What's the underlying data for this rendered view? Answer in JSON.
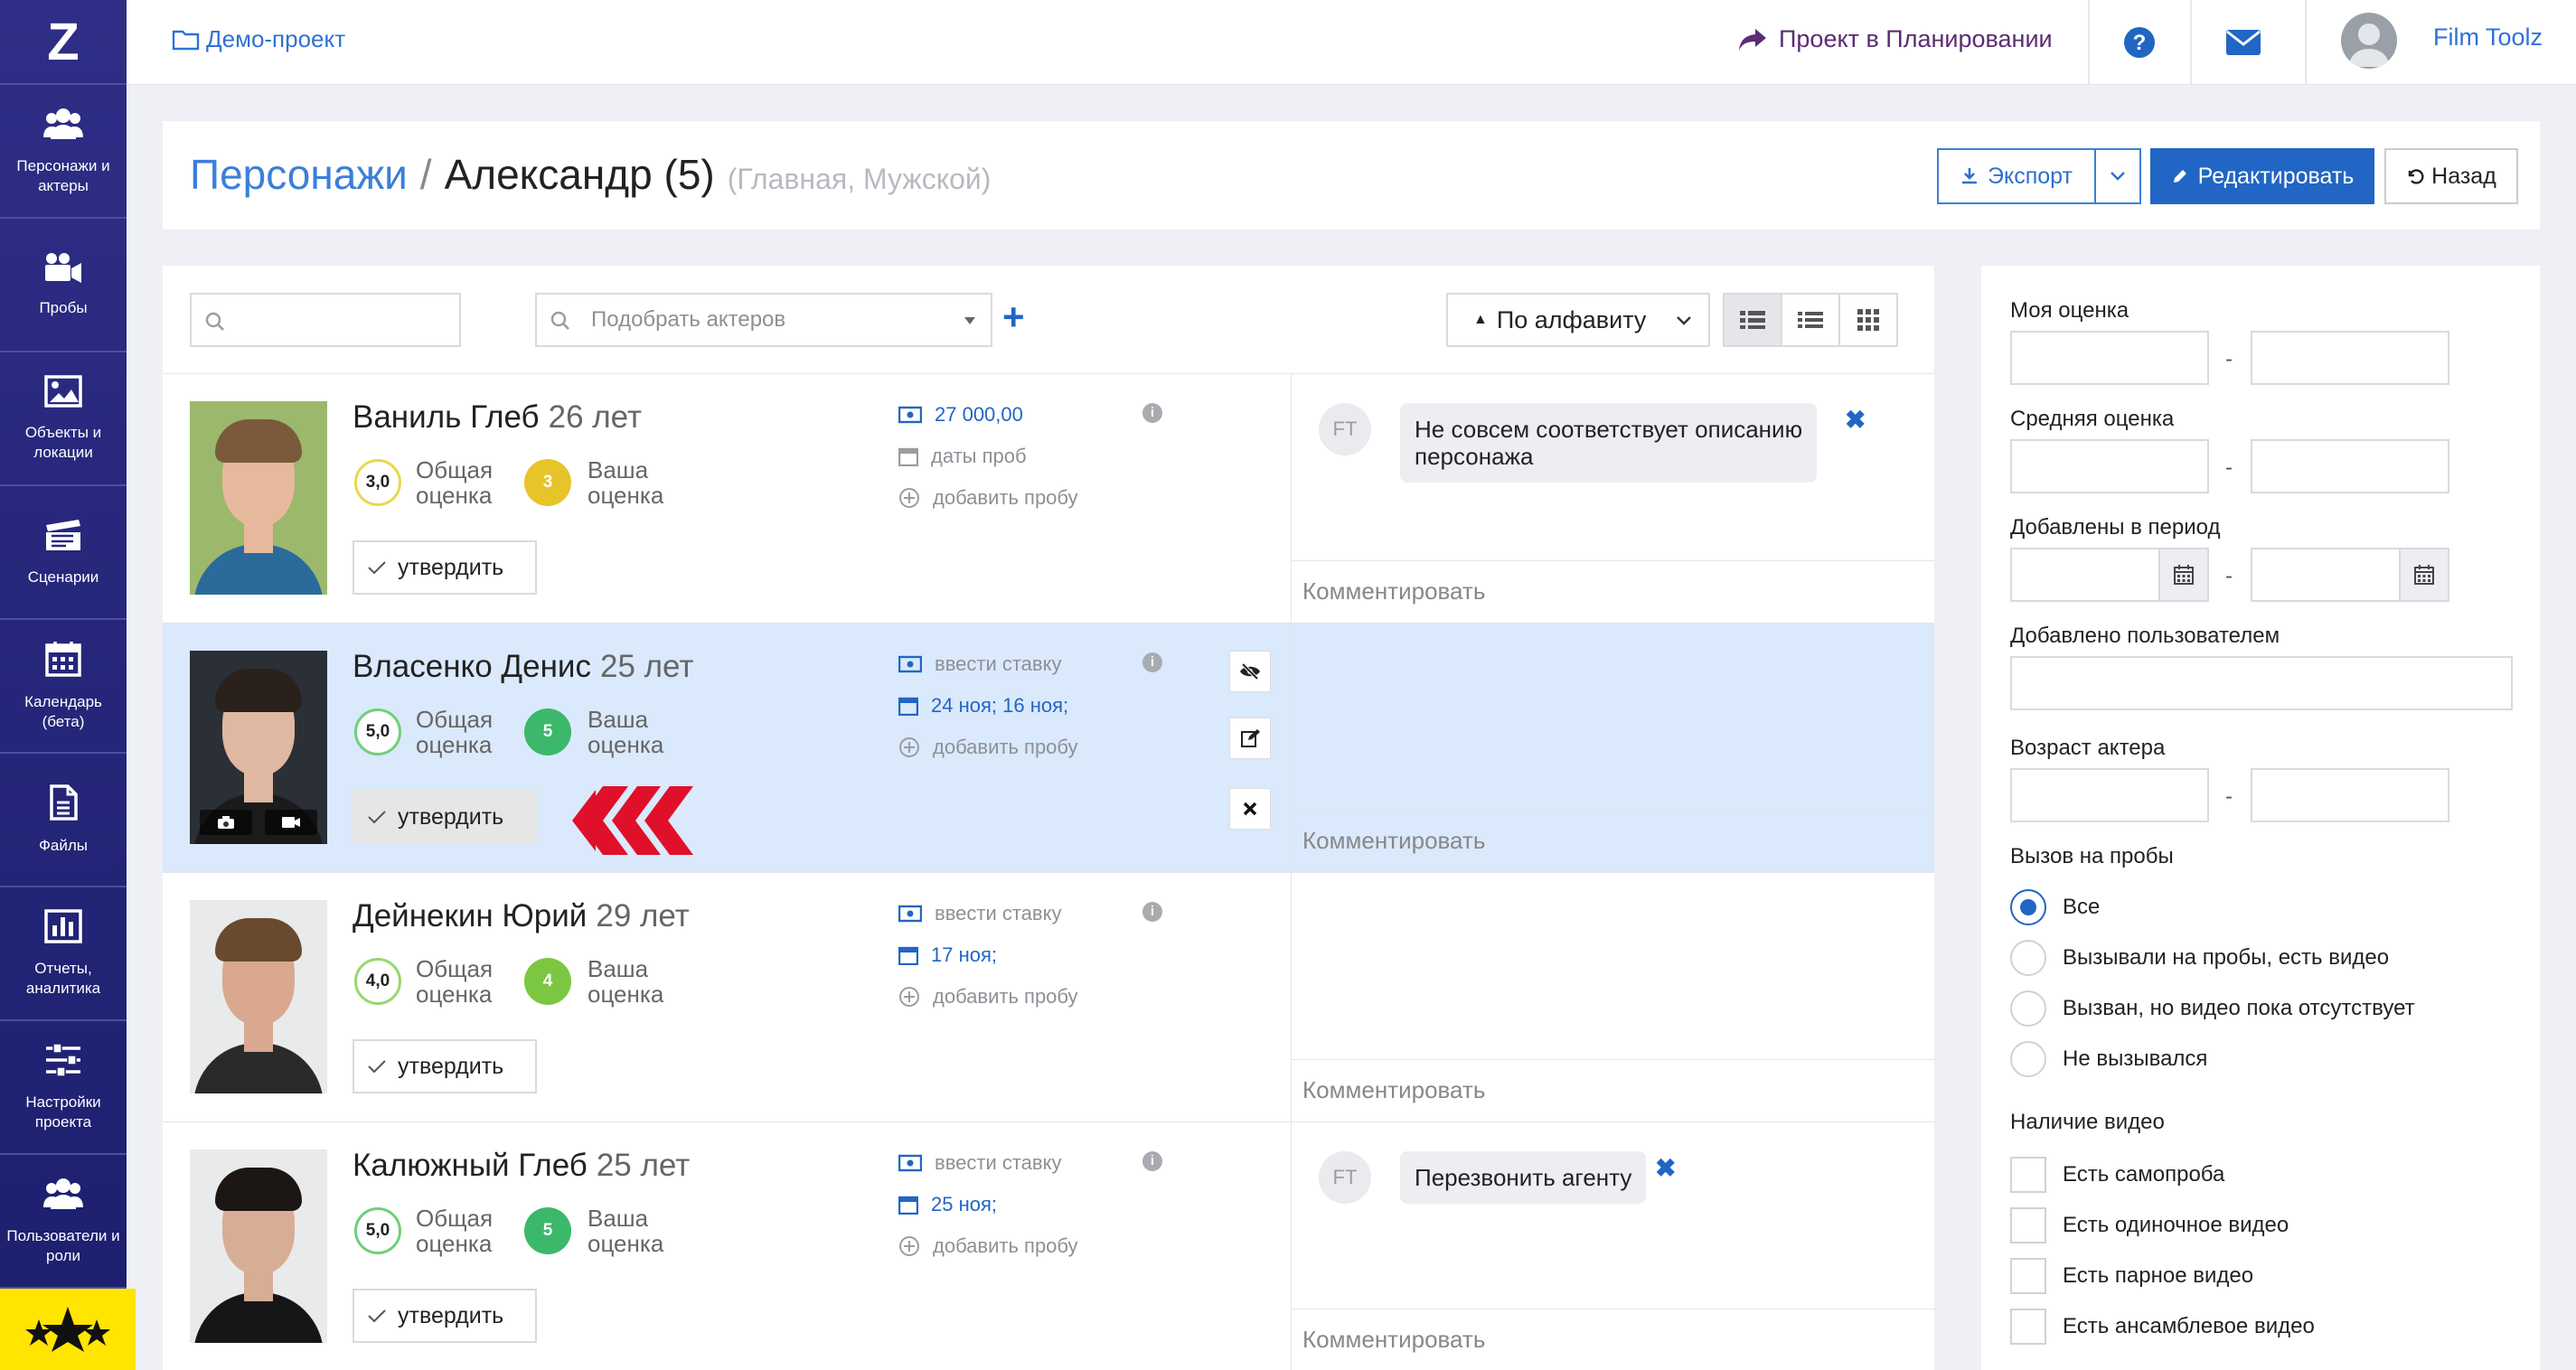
{
  "sidebar": {
    "logo": "Z",
    "items": [
      {
        "label": "Персонажи и актеры",
        "icon": "users-icon"
      },
      {
        "label": "Пробы",
        "icon": "video-camera-icon"
      },
      {
        "label": "Объекты и локации",
        "icon": "image-icon"
      },
      {
        "label": "Сценарии",
        "icon": "clapperboard-icon"
      },
      {
        "label": "Календарь (бета)",
        "icon": "calendar-icon"
      },
      {
        "label": "Файлы",
        "icon": "file-icon"
      },
      {
        "label": "Отчеты, аналитика",
        "icon": "bar-chart-icon"
      },
      {
        "label": "Настройки проекта",
        "icon": "sliders-icon"
      },
      {
        "label": "Пользователи и роли",
        "icon": "users-icon"
      }
    ]
  },
  "topbar": {
    "project": "Демо-проект",
    "status": "Проект в Планировании",
    "user": "Film Toolz"
  },
  "header": {
    "crumb_root": "Персонажи",
    "separator": "/",
    "title": "Александр (5)",
    "subtitle": "(Главная, Мужской)",
    "export": "Экспорт",
    "edit": "Редактировать",
    "back": "Назад"
  },
  "controls": {
    "search_placeholder": "",
    "pick_placeholder": "Подобрать актеров",
    "add": "+",
    "sort": "По алфавиту"
  },
  "labels": {
    "overall": "Общая\nоценка",
    "yours": "Ваша\nоценка",
    "approve": "утвердить",
    "add_trial": "добавить пробу",
    "comment": "Комментировать"
  },
  "actors": [
    {
      "name": "Ваниль Глеб",
      "age": "26 лет",
      "overall": "3,0",
      "mine": "3",
      "mine_color": "#e6c42a",
      "ring": "#e8d84a",
      "rate": "27 000,00",
      "rate_set": true,
      "dates": "даты проб",
      "dates_set": false,
      "comment": {
        "initials": "FT",
        "text": "Не совсем соответствует описанию\nперсонажа"
      }
    },
    {
      "name": "Власенко Денис",
      "age": "25 лет",
      "overall": "5,0",
      "mine": "5",
      "mine_color": "#3cb86a",
      "ring": "#6fcf7a",
      "rate": "ввести ставку",
      "rate_set": false,
      "dates": "24 ноя; 16 ноя;",
      "dates_set": true,
      "comment": null
    },
    {
      "name": "Дейнекин Юрий",
      "age": "29 лет",
      "overall": "4,0",
      "mine": "4",
      "mine_color": "#7cc742",
      "ring": "#98d66f",
      "rate": "ввести ставку",
      "rate_set": false,
      "dates": "17 ноя;",
      "dates_set": true,
      "comment": null
    },
    {
      "name": "Калюжный Глеб",
      "age": "25 лет",
      "overall": "5,0",
      "mine": "5",
      "mine_color": "#3cb86a",
      "ring": "#6fcf7a",
      "rate": "ввести ставку",
      "rate_set": false,
      "dates": "25 ноя;",
      "dates_set": true,
      "comment": {
        "initials": "FT",
        "text": "Перезвонить агенту"
      }
    }
  ],
  "filters": {
    "my_rating": "Моя оценка",
    "avg_rating": "Средняя оценка",
    "added_period": "Добавлены в период",
    "added_by": "Добавлено пользователем",
    "age": "Возраст актера",
    "dash": "-",
    "call_title": "Вызов на пробы",
    "call_options": [
      "Все",
      "Вызывали на пробы, есть видео",
      "Вызван, но видео пока отсутствует",
      "Не вызывался"
    ],
    "call_selected": 0,
    "video_title": "Наличие видео",
    "video_options": [
      "Есть самопроба",
      "Есть одиночное видео",
      "Есть парное видео",
      "Есть ансамблевое видео"
    ]
  },
  "colors": {
    "accent": "#2166c4",
    "sidebar": "#23277a",
    "selected_row": "#dae9fb",
    "arrows": "#e0102a"
  }
}
